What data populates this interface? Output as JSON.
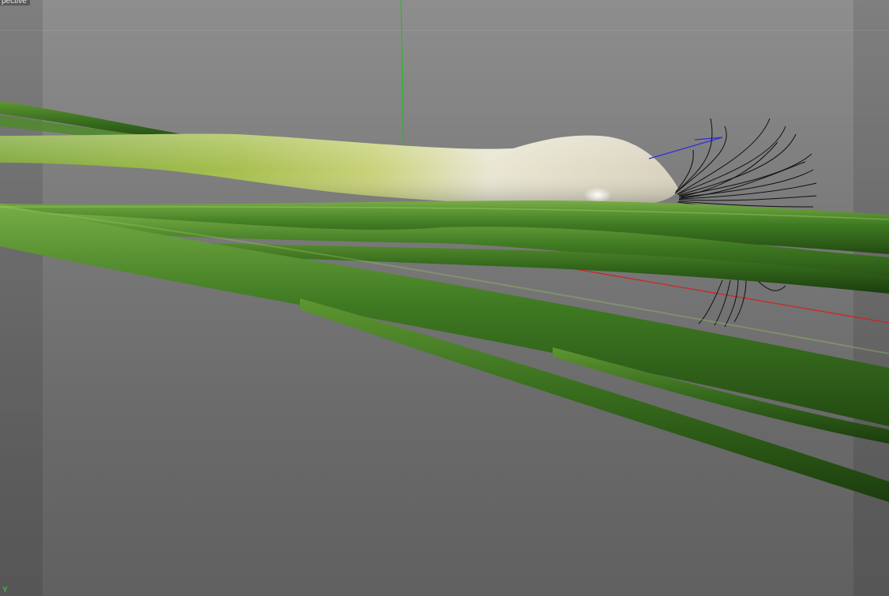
{
  "viewport": {
    "view_label": "pective",
    "axis_indicator": "Y"
  },
  "scene": {
    "object": "green onion",
    "axes": {
      "x_color": "#d42020",
      "y_color": "#1fc01f",
      "z_color": "#2d2dd8"
    },
    "colors": {
      "background_top": "#8e8e8e",
      "background_bottom": "#606060",
      "stalk_green": "#3f7a22",
      "stalk_highlight": "#6fa83c",
      "bulb_white": "#e9e6d8",
      "root": "#111111"
    }
  }
}
